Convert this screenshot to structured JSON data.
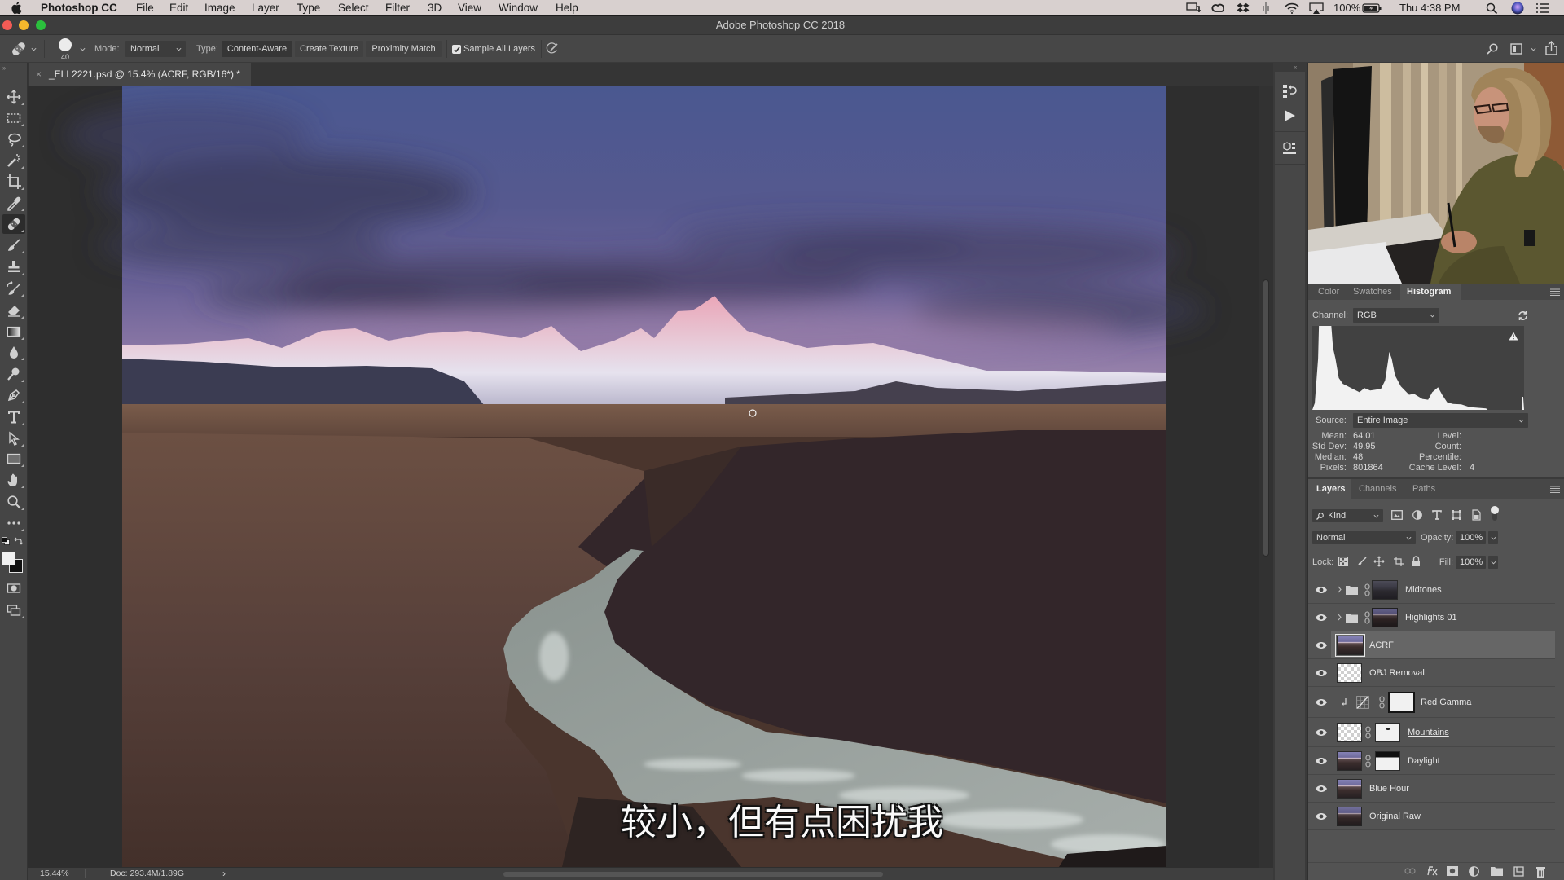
{
  "menubar": {
    "app_name": "Photoshop CC",
    "items": [
      "File",
      "Edit",
      "Image",
      "Layer",
      "Type",
      "Select",
      "Filter",
      "3D",
      "View",
      "Window",
      "Help"
    ],
    "status_icons": [
      "power-adapter-icon",
      "creative-cloud-icon",
      "dropbox-icon",
      "audio-input-icon",
      "wifi-icon",
      "airplay-icon",
      "battery-icon",
      "spotlight-icon",
      "siri-icon",
      "notification-center-icon"
    ],
    "battery_percent": "100%",
    "clock": "Thu 4:38 PM"
  },
  "window": {
    "title": "Adobe Photoshop CC 2018"
  },
  "options_bar": {
    "tool_preset_icon": "spot-healing-brush-icon",
    "brush_size": "40",
    "mode_label": "Mode:",
    "mode_value": "Normal",
    "type_label": "Type:",
    "type_buttons": [
      {
        "label": "Content-Aware",
        "selected": true
      },
      {
        "label": "Create Texture",
        "selected": false
      },
      {
        "label": "Proximity Match",
        "selected": false
      }
    ],
    "sample_all_layers_label": "Sample All Layers",
    "sample_all_layers_checked": true,
    "right_icons": [
      "search-icon",
      "workspace-icon",
      "share-icon"
    ]
  },
  "document": {
    "close_glyph": "×",
    "tab_title": "_ELL2221.psd @ 15.4% (ACRF, RGB/16*) *",
    "subtitle": "较小，但有点困扰我"
  },
  "status_bar": {
    "zoom": "15.44%",
    "doc_info": "Doc: 293.4M/1.89G",
    "more_glyph": "›"
  },
  "toolbar": {
    "collapse_glyph": "››",
    "tools": [
      "move-icon",
      "rectangular-marquee-icon",
      "lasso-icon",
      "quick-selection-icon",
      "crop-icon",
      "eyedropper-icon",
      "spot-healing-brush-icon",
      "brush-icon",
      "clone-stamp-icon",
      "history-brush-icon",
      "eraser-icon",
      "gradient-icon",
      "blur-icon",
      "dodge-icon",
      "pen-icon",
      "type-icon",
      "path-selection-icon",
      "rectangle-icon",
      "hand-icon",
      "zoom-icon",
      "edit-toolbar-icon",
      "default-colors-icon",
      "swap-colors-icon",
      "quick-mask-icon",
      "screen-mode-icon"
    ],
    "active_tool": "spot-healing-brush-icon",
    "foreground_color": "#f0f0f0",
    "background_color": "#111111"
  },
  "dock": {
    "collapse_glyph": "‹‹",
    "icons": [
      "history-panel-icon",
      "actions-panel-icon",
      "properties-panel-icon"
    ]
  },
  "histogram_panel": {
    "tabs": [
      {
        "label": "Color",
        "active": false
      },
      {
        "label": "Swatches",
        "active": false
      },
      {
        "label": "Histogram",
        "active": true
      }
    ],
    "channel_label": "Channel:",
    "channel_value": "RGB",
    "source_label": "Source:",
    "source_value": "Entire Image",
    "stats_left": [
      {
        "label": "Mean:",
        "value": "64.01"
      },
      {
        "label": "Std Dev:",
        "value": "49.95"
      },
      {
        "label": "Median:",
        "value": "48"
      },
      {
        "label": "Pixels:",
        "value": "801864"
      }
    ],
    "stats_right": [
      {
        "label": "Level:",
        "value": ""
      },
      {
        "label": "Count:",
        "value": ""
      },
      {
        "label": "Percentile:",
        "value": ""
      },
      {
        "label": "Cache Level:",
        "value": "4"
      }
    ],
    "warning_icon": "cache-warning-icon",
    "histogram": {
      "x_unit": "level (0-255)",
      "y_unit": "relative pixel count (0-1, clipped)",
      "points": [
        [
          0,
          0
        ],
        [
          3,
          0.08
        ],
        [
          7,
          0.61
        ],
        [
          8,
          1.0
        ],
        [
          23,
          1.0
        ],
        [
          25,
          0.74
        ],
        [
          28,
          0.61
        ],
        [
          32,
          0.38
        ],
        [
          37,
          0.31
        ],
        [
          47,
          0.26
        ],
        [
          57,
          0.21
        ],
        [
          63,
          0.26
        ],
        [
          70,
          0.23
        ],
        [
          83,
          0.25
        ],
        [
          88,
          0.35
        ],
        [
          92,
          0.61
        ],
        [
          93,
          0.69
        ],
        [
          96,
          0.61
        ],
        [
          100,
          0.41
        ],
        [
          107,
          0.28
        ],
        [
          117,
          0.18
        ],
        [
          123,
          0.19
        ],
        [
          133,
          0.13
        ],
        [
          140,
          0.12
        ],
        [
          145,
          0.21
        ],
        [
          152,
          0.27
        ],
        [
          157,
          0.18
        ],
        [
          163,
          0.09
        ],
        [
          170,
          0.07
        ],
        [
          180,
          0.066
        ],
        [
          190,
          0.033
        ],
        [
          210,
          0.017
        ],
        [
          212,
          0
        ],
        [
          253,
          0
        ],
        [
          254,
          0.155
        ],
        [
          255,
          0.155
        ]
      ]
    }
  },
  "layers_panel": {
    "tabs": [
      {
        "label": "Layers",
        "active": true
      },
      {
        "label": "Channels",
        "active": false
      },
      {
        "label": "Paths",
        "active": false
      }
    ],
    "filter_kind": "Kind",
    "blend_mode": "Normal",
    "opacity_label": "Opacity:",
    "opacity_value": "100%",
    "lock_label": "Lock:",
    "fill_label": "Fill:",
    "fill_value": "100%",
    "layers": [
      {
        "name": "Midtones",
        "kind": "group",
        "visible": true,
        "selected": false
      },
      {
        "name": "Highlights 01",
        "kind": "group",
        "visible": true,
        "selected": false
      },
      {
        "name": "ACRF",
        "kind": "pixel",
        "visible": true,
        "selected": true
      },
      {
        "name": "OBJ Removal",
        "kind": "pixel-transparent",
        "visible": true,
        "selected": false
      },
      {
        "name": "Red Gamma",
        "kind": "curves-adjustment",
        "clipped": true,
        "has_mask": true,
        "visible": true,
        "selected": false
      },
      {
        "name": "Mountains",
        "kind": "pixel-transparent",
        "has_mask": true,
        "visible": true,
        "selected": false
      },
      {
        "name": "Daylight",
        "kind": "pixel",
        "has_mask": true,
        "visible": true,
        "selected": false
      },
      {
        "name": "Blue Hour",
        "kind": "pixel",
        "visible": true,
        "selected": false
      },
      {
        "name": "Original Raw",
        "kind": "pixel",
        "visible": true,
        "selected": false
      }
    ],
    "bottom_icons": [
      "link-layers-icon",
      "layer-style-fx-icon",
      "add-mask-icon",
      "new-adjustment-icon",
      "new-group-icon",
      "new-layer-icon",
      "delete-layer-icon"
    ]
  }
}
